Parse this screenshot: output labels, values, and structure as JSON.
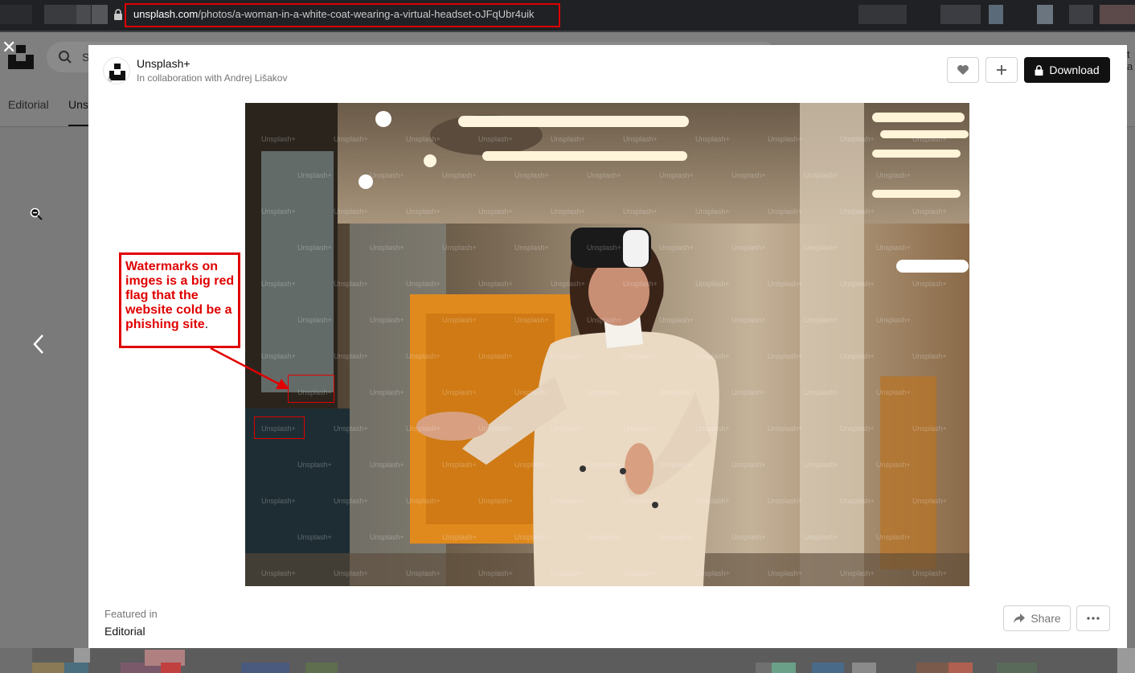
{
  "browser": {
    "url_domain": "unsplash.com",
    "url_path": "/photos/a-woman-in-a-white-coat-wearing-a-virtual-headset-oJFqUbr4uik"
  },
  "page": {
    "search_partial": "S",
    "nav": [
      "Editorial",
      "Uns"
    ],
    "right_peek": "t a"
  },
  "modal": {
    "owner_name": "Unsplash+",
    "owner_sub": "In collaboration with Andrej Lišakov",
    "download_label": "Download",
    "watermark_text": "Unsplash+",
    "featured_label": "Featured in",
    "featured_value": "Editorial",
    "share_label": "Share"
  },
  "annotation": {
    "line1": "Watermarks on",
    "line2": "imges is a big red",
    "line3": "flag that the",
    "line4": "website cold be a",
    "line5": "phishing site",
    "line5_end": "."
  },
  "colors": {
    "annotation_red": "#e00000",
    "download_bg": "#111111",
    "photo_orange": "#e08a1e"
  },
  "icons": [
    "lock-icon",
    "search-icon",
    "close-icon",
    "zoom-out-icon",
    "chevron-left-icon",
    "heart-icon",
    "plus-icon",
    "share-icon",
    "more-icon"
  ]
}
